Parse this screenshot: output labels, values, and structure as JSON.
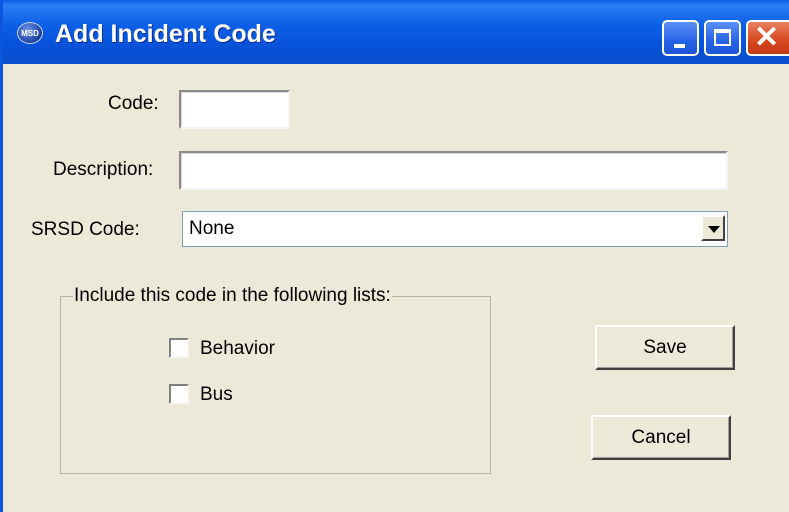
{
  "window": {
    "title": "Add Incident Code",
    "app_icon_text": "MSD",
    "close_glyph": "✕"
  },
  "form": {
    "code_label": "Code:",
    "code_value": "",
    "description_label": "Description:",
    "description_value": "",
    "srsd_label": "SRSD Code:",
    "srsd_value": "None"
  },
  "lists_group": {
    "legend": "Include this code in the following lists:",
    "options": [
      {
        "label": "Behavior",
        "checked": false
      },
      {
        "label": "Bus",
        "checked": false
      }
    ]
  },
  "buttons": {
    "save": "Save",
    "cancel": "Cancel"
  }
}
